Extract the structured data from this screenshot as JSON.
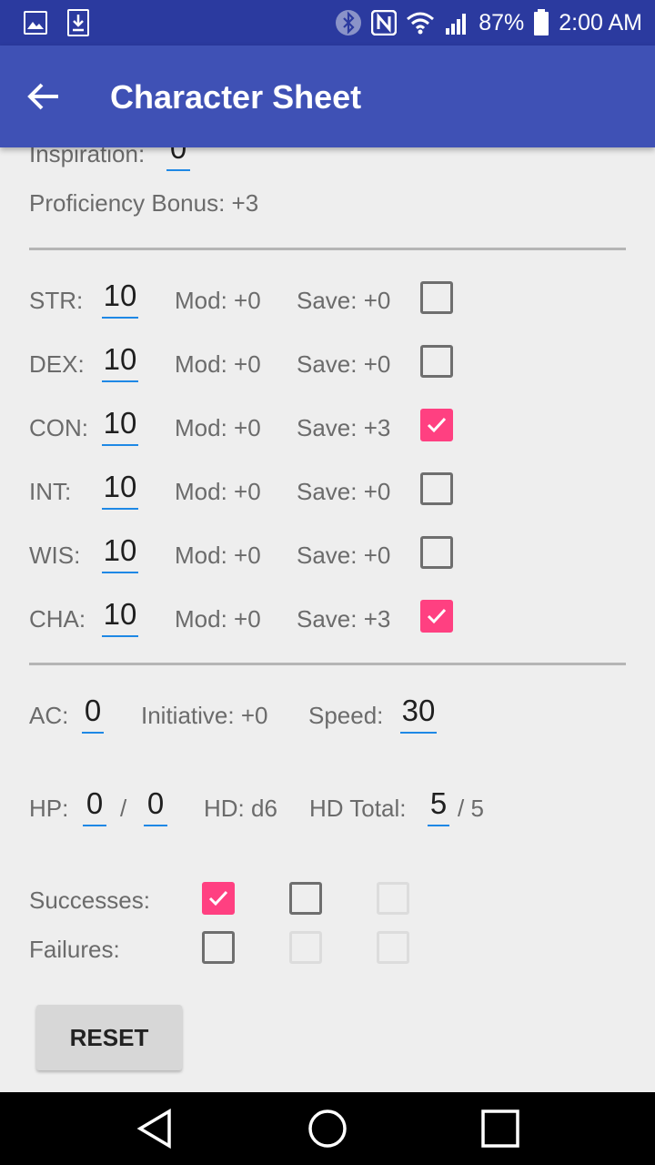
{
  "status_bar": {
    "battery": "87%",
    "time": "2:00 AM",
    "icons": [
      "image-icon",
      "download-icon",
      "bluetooth-icon",
      "nfc-icon",
      "wifi-icon",
      "signal-icon",
      "battery-icon"
    ]
  },
  "app_bar": {
    "title": "Character Sheet",
    "back_icon": "arrow-back-icon"
  },
  "top": {
    "inspiration_label": "Inspiration:",
    "inspiration_value": "0",
    "proficiency_text": "Proficiency Bonus: +3"
  },
  "abilities": [
    {
      "label": "STR:",
      "score": "10",
      "mod": "Mod: +0",
      "save": "Save: +0",
      "proficient": false
    },
    {
      "label": "DEX:",
      "score": "10",
      "mod": "Mod: +0",
      "save": "Save: +0",
      "proficient": false
    },
    {
      "label": "CON:",
      "score": "10",
      "mod": "Mod: +0",
      "save": "Save: +3",
      "proficient": true
    },
    {
      "label": "INT:",
      "score": "10",
      "mod": "Mod: +0",
      "save": "Save: +0",
      "proficient": false
    },
    {
      "label": "WIS:",
      "score": "10",
      "mod": "Mod: +0",
      "save": "Save: +0",
      "proficient": false
    },
    {
      "label": "CHA:",
      "score": "10",
      "mod": "Mod: +0",
      "save": "Save: +3",
      "proficient": true
    }
  ],
  "combat": {
    "ac_label": "AC:",
    "ac_value": "0",
    "initiative": "Initiative: +0",
    "speed_label": "Speed:",
    "speed_value": "30"
  },
  "hp": {
    "label": "HP:",
    "current": "0",
    "slash": "/",
    "max": "0",
    "hd": "HD: d6",
    "hd_total_label": "HD Total:",
    "hd_total_value": "5",
    "hd_total_max": "/ 5"
  },
  "death_saves": {
    "successes_label": "Successes:",
    "failures_label": "Failures:",
    "successes": [
      true,
      false,
      false
    ],
    "failures": [
      false,
      false,
      false
    ]
  },
  "reset_label": "RESET",
  "colors": {
    "status_bar": "#2b3a9f",
    "app_bar": "#3f51b5",
    "accent": "#ff4081",
    "underline": "#1e88e5",
    "background": "#eeeeee"
  }
}
